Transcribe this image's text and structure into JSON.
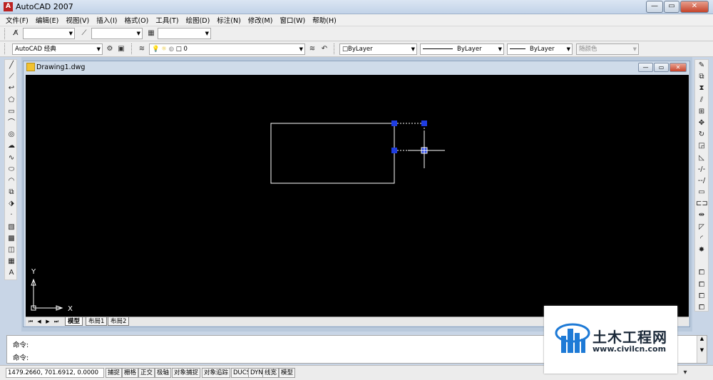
{
  "app": {
    "title": "AutoCAD 2007",
    "icon_label": "A"
  },
  "window_buttons": {
    "minimize": "—",
    "maximize": "▭",
    "close": "✕"
  },
  "menu": [
    "文件(F)",
    "编辑(E)",
    "视图(V)",
    "插入(I)",
    "格式(O)",
    "工具(T)",
    "绘图(D)",
    "标注(N)",
    "修改(M)",
    "窗口(W)",
    "帮助(H)"
  ],
  "toolbar2": {
    "workspace": "AutoCAD 经典",
    "layer": "0",
    "color": "□ByLayer",
    "linetype": "ByLayer",
    "lineweight": "ByLayer",
    "plotstyle": "随颜色"
  },
  "drawing": {
    "title": "Drawing1.dwg"
  },
  "layout_tabs": {
    "model": "模型",
    "layout1": "布局1",
    "layout2": "布局2"
  },
  "ucs": {
    "x_label": "X",
    "y_label": "Y"
  },
  "command": {
    "line1": "命令:",
    "line2": "命令:"
  },
  "status": {
    "coords": "1479.2660, 701.6912, 0.0000",
    "toggles": [
      "捕捉",
      "栅格",
      "正交",
      "极轴",
      "对象捕捉",
      "对象追踪",
      "DUCS",
      "DYN",
      "线宽",
      "模型"
    ]
  },
  "watermark": {
    "title": "土木工程网",
    "url": "www.civilcn.com"
  },
  "colors": {
    "canvas": "#000000",
    "entity": "#ffffff",
    "grip": "#1f3de0",
    "watermark_blue": "#1e7ad6"
  },
  "icons": {
    "left_toolbar": [
      "line-icon",
      "construction-line-icon",
      "polyline-icon",
      "polygon-icon",
      "rectangle-icon",
      "arc-icon",
      "circle-icon",
      "revision-cloud-icon",
      "spline-icon",
      "ellipse-icon",
      "ellipse-arc-icon",
      "insert-block-icon",
      "make-block-icon",
      "point-icon",
      "hatch-icon",
      "gradient-icon",
      "region-icon",
      "table-icon",
      "multiline-text-icon"
    ],
    "right_toolbar": [
      "erase-icon",
      "copy-icon",
      "mirror-icon",
      "offset-icon",
      "array-icon",
      "move-icon",
      "rotate-icon",
      "scale-icon",
      "stretch-icon",
      "trim-icon",
      "extend-icon",
      "break-at-point-icon",
      "break-icon",
      "join-icon",
      "chamfer-icon",
      "fillet-icon",
      "explode-icon",
      "draw-order-front-icon",
      "draw-order-back-icon",
      "draw-order-above-icon",
      "draw-order-under-icon"
    ]
  }
}
